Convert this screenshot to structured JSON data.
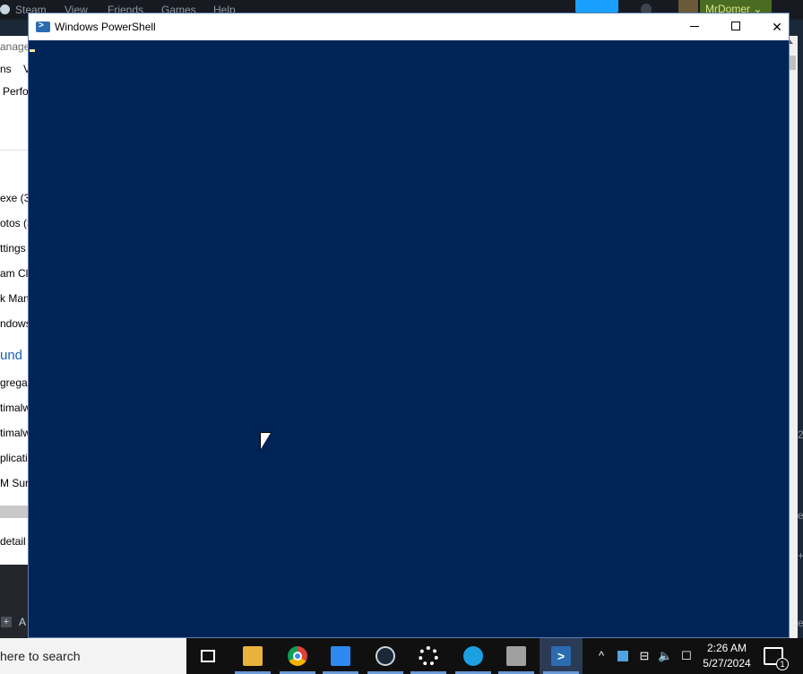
{
  "steam_bar": {
    "items": [
      "Steam",
      "View",
      "Friends",
      "Games",
      "Help"
    ],
    "username": "MrDomer"
  },
  "task_manager": {
    "title_fragment": "anage",
    "menu_fragments": [
      "ns",
      "V"
    ],
    "tab_fragment": "Perfo",
    "rows": [
      "exe (3",
      "otos (3",
      "ttings",
      "am Cl",
      "k Man",
      "ndows"
    ],
    "group_label": "und",
    "bg_rows": [
      "gregat",
      "timalw",
      "timalw",
      "plicati",
      "M Sur"
    ],
    "details": "detail"
  },
  "right_fragment": [
    "2",
    "e",
    "+",
    "e"
  ],
  "powershell": {
    "title": "Windows PowerShell",
    "minimize": "—",
    "maximize": "☐",
    "close": "✕"
  },
  "taskbar": {
    "search_text": "here to search",
    "apps": [
      {
        "name": "task-view",
        "active": false
      },
      {
        "name": "file-explorer",
        "active": false
      },
      {
        "name": "chrome",
        "active": false
      },
      {
        "name": "photos",
        "active": false
      },
      {
        "name": "steam",
        "active": false
      },
      {
        "name": "settings",
        "active": false
      },
      {
        "name": "developer-app",
        "active": false
      },
      {
        "name": "calculator",
        "active": false
      },
      {
        "name": "powershell",
        "active": true
      }
    ],
    "tray": {
      "chevron": "^",
      "time": "2:26 AM",
      "date": "5/27/2024",
      "notification_count": "1"
    }
  }
}
